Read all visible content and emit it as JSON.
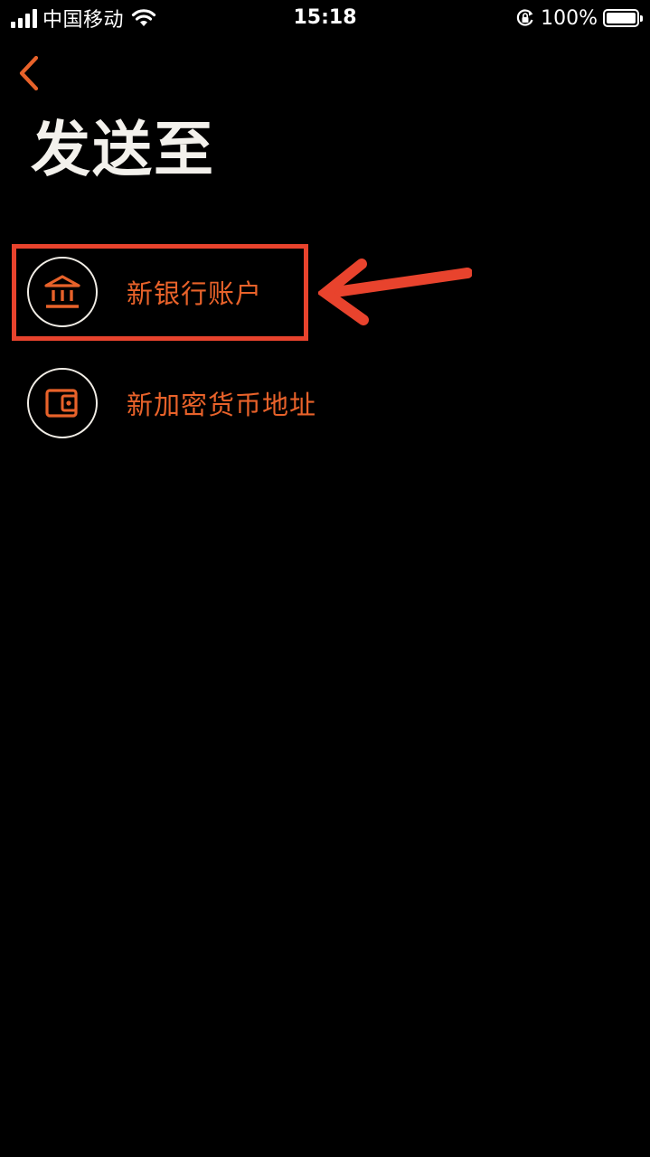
{
  "status_bar": {
    "carrier": "中国移动",
    "time": "15:18",
    "battery_percent": "100%",
    "battery_level": 1.0
  },
  "header": {
    "back_icon": "chevron-left-icon",
    "title": "发送至"
  },
  "options": [
    {
      "label": "新银行账户",
      "icon": "bank-icon"
    },
    {
      "label": "新加密货币地址",
      "icon": "wallet-icon"
    }
  ],
  "colors": {
    "accent": "#e8622a",
    "background": "#000000",
    "title": "#f3f1ec",
    "annotation": "#e8432d"
  }
}
